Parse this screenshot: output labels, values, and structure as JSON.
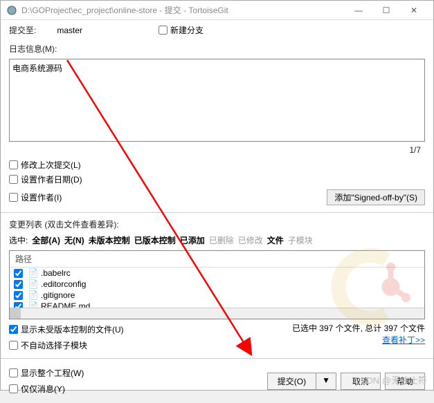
{
  "titlebar": {
    "path": "D:\\GOProject\\ec_project\\online-store - 提交 - TortoiseGit"
  },
  "commit_to": {
    "label": "提交至:",
    "branch": "master"
  },
  "new_branch": {
    "label": "新建分支"
  },
  "log_label": "日志信息(M):",
  "log_message": "电商系统源码",
  "counter": "1/7",
  "opts": {
    "amend": "修改上次提交(L)",
    "set_author_date": "设置作者日期(D)",
    "set_author": "设置作者(I)"
  },
  "signed_off": "添加\"Signed-off-by\"(S)",
  "changelist": {
    "header": "变更列表 (双击文件查看差异):",
    "select_label": "选中:",
    "filters": {
      "all": "全部(A)",
      "none": "无(N)",
      "unversioned": "未版本控制",
      "versioned": "已版本控制",
      "added": "已添加",
      "deleted": "已删除",
      "modified": "已修改",
      "files": "文件",
      "submodules": "子模块"
    },
    "col_path": "路径",
    "files": [
      {
        "name": ".babelrc"
      },
      {
        "name": ".editorconfig"
      },
      {
        "name": ".gitignore"
      },
      {
        "name": "README.md"
      }
    ]
  },
  "status": {
    "summary": "已选中 397 个文件, 总计 397 个文件"
  },
  "options_below": {
    "show_unversioned": "显示未受版本控制的文件(U)",
    "no_auto_submodule": "不自动选择子模块",
    "show_whole_project": "显示整个工程(W)",
    "message_only": "仅仅消息(Y)"
  },
  "patch_link": "查看补丁>>",
  "buttons": {
    "commit": "提交(O)",
    "cancel": "取消",
    "help": "帮助"
  },
  "watermark_text": "CSDN @无往止符"
}
